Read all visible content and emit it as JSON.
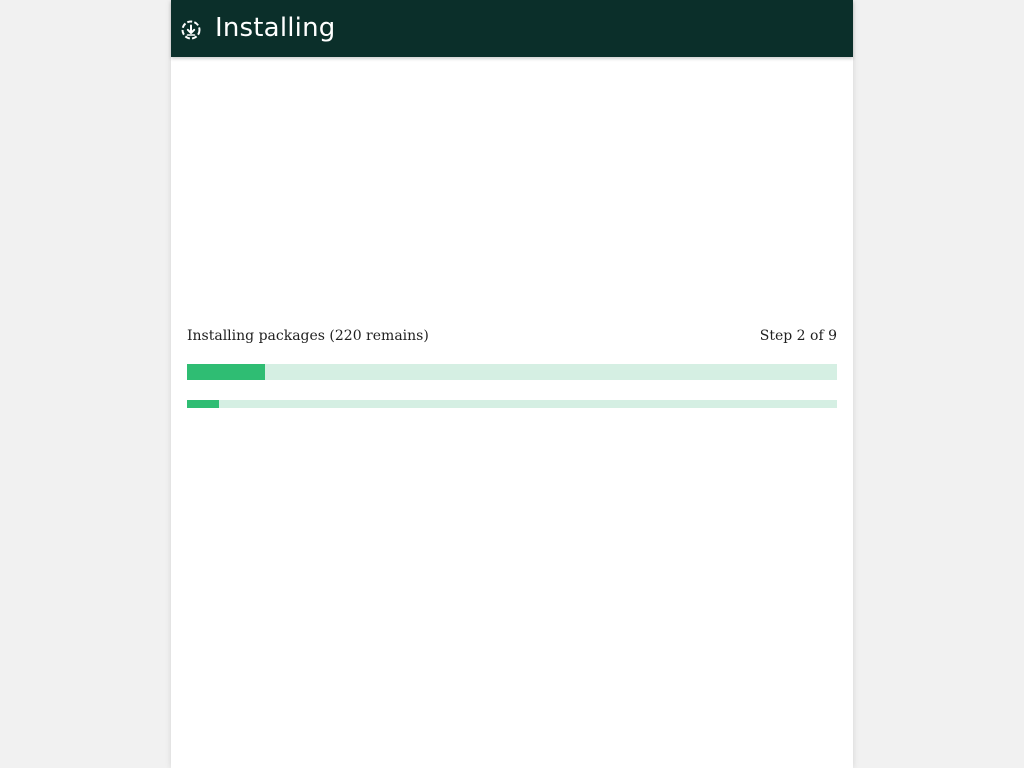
{
  "header": {
    "title": "Installing",
    "icon": "download-circle-icon"
  },
  "status": {
    "message": "Installing packages (220 remains)",
    "step_text": "Step 2 of 9"
  },
  "progress": {
    "overall_fraction": 0.12,
    "current_fraction": 0.049
  },
  "colors": {
    "header_bg": "#0b2f2a",
    "accent": "#2fbd73",
    "track": "#d5efe3",
    "page_bg": "#f1f1f1"
  }
}
